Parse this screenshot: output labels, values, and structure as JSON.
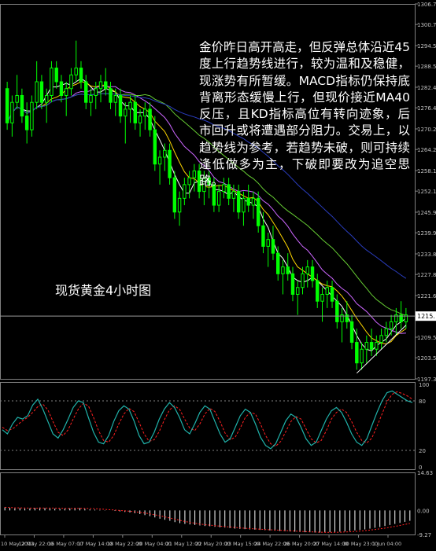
{
  "commentary": "金价昨日高开高走，但反弹总体沿近45度上行趋势线进行，较为温和及稳健，现涨势有所暂缓。MACD指标仍保持底背离形态缓慢上行，但现价接近MA40反压，且KD指标高位有转向迹象，后市回升或将遭遇部分阻力。交易上，以趋势线为参考，若趋势未破，则可持续逢低做多为主，下破即要改为追空思路。",
  "caption": "现货黄金4小时图",
  "colors": {
    "background": "#000000",
    "candle": "#00ff00",
    "ma_fast": "#ffffff",
    "ma_mid": "#ffd700",
    "ma_slow": "#cc66ff",
    "ma_long": "#66cc33",
    "ma_longest": "#2a3dbf",
    "kd_k": "#20b2aa",
    "kd_d": "#ff2020",
    "macd_hist": "#ffffff",
    "macd_signal": "#ff2020",
    "grid": "#808080",
    "axis_text": "#c0c0c0"
  },
  "chart_data": {
    "type": "candlestick",
    "price_axis": {
      "ticks": [
        "1306.70",
        "1300.70",
        "1294.55",
        "1288.55",
        "1282.40",
        "1276.40",
        "1270.25",
        "1264.25",
        "1258.10",
        "1252.10",
        "1245.95",
        "1239.95",
        "1233.80",
        "1227.80",
        "1221.65",
        "1215.65",
        "1209.50",
        "1203.50",
        "1197.35"
      ],
      "ylim": [
        1197.35,
        1306.7
      ],
      "current_price": "1215."
    },
    "kd_axis": {
      "ticks": [
        "100",
        "80",
        "20",
        "0"
      ],
      "ylim": [
        0,
        100
      ]
    },
    "macd_axis": {
      "ticks": [
        "14.63",
        "0.00",
        "-9.27"
      ],
      "ylim": [
        -9.27,
        14.63
      ]
    },
    "time_axis": [
      "10 May 2013",
      "12 May 22:00",
      "16 May 07:00",
      "17 May 14:00",
      "18 May 22:00",
      "20 May 04:00",
      "21 May 12:00",
      "22 May 20:00",
      "23 May 15:00",
      "24 May 22:00",
      "26 May 20:00",
      "27 May 14:00",
      "30 May 23:00",
      "1 Jun 04:00"
    ],
    "candles": [
      [
        1282,
        1284,
        1270,
        1272
      ],
      [
        1272,
        1280,
        1268,
        1278
      ],
      [
        1278,
        1286,
        1276,
        1280
      ],
      [
        1280,
        1282,
        1272,
        1274
      ],
      [
        1274,
        1278,
        1266,
        1270
      ],
      [
        1270,
        1280,
        1268,
        1278
      ],
      [
        1278,
        1290,
        1276,
        1284
      ],
      [
        1284,
        1286,
        1276,
        1278
      ],
      [
        1278,
        1282,
        1272,
        1280
      ],
      [
        1280,
        1290,
        1278,
        1288
      ],
      [
        1288,
        1290,
        1282,
        1284
      ],
      [
        1284,
        1286,
        1278,
        1280
      ],
      [
        1280,
        1284,
        1274,
        1282
      ],
      [
        1282,
        1288,
        1280,
        1286
      ],
      [
        1286,
        1296,
        1284,
        1288
      ],
      [
        1288,
        1290,
        1282,
        1284
      ],
      [
        1284,
        1286,
        1276,
        1278
      ],
      [
        1278,
        1282,
        1274,
        1280
      ],
      [
        1280,
        1284,
        1276,
        1282
      ],
      [
        1282,
        1286,
        1278,
        1284
      ],
      [
        1284,
        1288,
        1280,
        1282
      ],
      [
        1282,
        1284,
        1276,
        1278
      ],
      [
        1278,
        1282,
        1274,
        1280
      ],
      [
        1280,
        1282,
        1272,
        1274
      ],
      [
        1274,
        1278,
        1266,
        1276
      ],
      [
        1276,
        1280,
        1272,
        1278
      ],
      [
        1278,
        1280,
        1270,
        1272
      ],
      [
        1272,
        1276,
        1268,
        1274
      ],
      [
        1274,
        1278,
        1270,
        1276
      ],
      [
        1276,
        1278,
        1268,
        1270
      ],
      [
        1270,
        1274,
        1258,
        1260
      ],
      [
        1260,
        1264,
        1254,
        1262
      ],
      [
        1262,
        1266,
        1258,
        1264
      ],
      [
        1264,
        1266,
        1254,
        1256
      ],
      [
        1256,
        1258,
        1244,
        1246
      ],
      [
        1246,
        1252,
        1242,
        1250
      ],
      [
        1250,
        1256,
        1248,
        1254
      ],
      [
        1254,
        1258,
        1250,
        1256
      ],
      [
        1256,
        1260,
        1252,
        1258
      ],
      [
        1258,
        1260,
        1250,
        1252
      ],
      [
        1252,
        1258,
        1248,
        1256
      ],
      [
        1256,
        1258,
        1250,
        1254
      ],
      [
        1254,
        1256,
        1246,
        1248
      ],
      [
        1248,
        1254,
        1246,
        1252
      ],
      [
        1252,
        1256,
        1250,
        1254
      ],
      [
        1254,
        1256,
        1248,
        1250
      ],
      [
        1250,
        1254,
        1246,
        1252
      ],
      [
        1252,
        1254,
        1244,
        1246
      ],
      [
        1246,
        1252,
        1242,
        1250
      ],
      [
        1250,
        1254,
        1246,
        1248
      ],
      [
        1248,
        1252,
        1244,
        1250
      ],
      [
        1250,
        1252,
        1240,
        1242
      ],
      [
        1242,
        1246,
        1234,
        1236
      ],
      [
        1236,
        1240,
        1230,
        1238
      ],
      [
        1238,
        1242,
        1232,
        1234
      ],
      [
        1234,
        1236,
        1226,
        1228
      ],
      [
        1228,
        1232,
        1222,
        1230
      ],
      [
        1230,
        1234,
        1226,
        1228
      ],
      [
        1228,
        1230,
        1220,
        1222
      ],
      [
        1222,
        1226,
        1216,
        1224
      ],
      [
        1224,
        1230,
        1222,
        1228
      ],
      [
        1228,
        1232,
        1224,
        1230
      ],
      [
        1230,
        1232,
        1224,
        1226
      ],
      [
        1226,
        1228,
        1218,
        1220
      ],
      [
        1220,
        1224,
        1214,
        1222
      ],
      [
        1222,
        1226,
        1218,
        1224
      ],
      [
        1224,
        1226,
        1218,
        1220
      ],
      [
        1220,
        1222,
        1212,
        1214
      ],
      [
        1214,
        1218,
        1208,
        1216
      ],
      [
        1216,
        1220,
        1212,
        1214
      ],
      [
        1214,
        1216,
        1206,
        1208
      ],
      [
        1208,
        1212,
        1200,
        1202
      ],
      [
        1202,
        1208,
        1200,
        1206
      ],
      [
        1206,
        1210,
        1202,
        1208
      ],
      [
        1208,
        1212,
        1204,
        1206
      ],
      [
        1206,
        1210,
        1204,
        1208
      ],
      [
        1208,
        1212,
        1206,
        1210
      ],
      [
        1210,
        1214,
        1208,
        1212
      ],
      [
        1212,
        1216,
        1210,
        1214
      ],
      [
        1214,
        1218,
        1210,
        1216
      ],
      [
        1216,
        1220,
        1212,
        1214
      ],
      [
        1214,
        1218,
        1212,
        1216
      ]
    ],
    "kd_k": [
      45,
      40,
      52,
      60,
      58,
      62,
      75,
      82,
      70,
      55,
      40,
      35,
      45,
      58,
      72,
      80,
      78,
      60,
      42,
      30,
      28,
      38,
      55,
      68,
      74,
      70,
      56,
      38,
      28,
      30,
      42,
      58,
      70,
      78,
      72,
      60,
      45,
      40,
      52,
      66,
      74,
      70,
      55,
      40,
      30,
      34,
      48,
      62,
      70,
      66,
      52,
      36,
      26,
      22,
      28,
      42,
      56,
      64,
      60,
      48,
      34,
      26,
      30,
      44,
      58,
      68,
      72,
      66,
      54,
      40,
      30,
      26,
      34,
      50,
      66,
      80,
      90,
      92,
      88,
      84,
      80,
      78
    ],
    "kd_d": [
      48,
      44,
      46,
      51,
      56,
      60,
      66,
      73,
      76,
      69,
      55,
      42,
      38,
      45,
      58,
      70,
      77,
      74,
      60,
      44,
      32,
      30,
      38,
      52,
      64,
      71,
      67,
      54,
      40,
      31,
      33,
      43,
      57,
      69,
      74,
      70,
      58,
      47,
      44,
      52,
      64,
      71,
      67,
      55,
      41,
      33,
      36,
      47,
      60,
      66,
      64,
      52,
      38,
      28,
      25,
      31,
      43,
      55,
      61,
      58,
      46,
      34,
      29,
      32,
      44,
      58,
      66,
      70,
      66,
      55,
      42,
      32,
      29,
      35,
      49,
      64,
      79,
      88,
      91,
      89,
      86,
      82
    ],
    "macd_hist": [
      1.2,
      1.0,
      0.8,
      0.9,
      0.7,
      0.8,
      1.0,
      1.1,
      0.9,
      0.8,
      0.7,
      0.6,
      0.7,
      0.8,
      1.0,
      0.9,
      0.6,
      0.4,
      0.3,
      0.2,
      0.1,
      0.0,
      -0.2,
      -0.4,
      -0.6,
      -0.8,
      -1.1,
      -1.4,
      -1.8,
      -2.2,
      -2.7,
      -3.2,
      -3.6,
      -4.0,
      -4.5,
      -4.9,
      -5.2,
      -5.4,
      -5.6,
      -5.8,
      -6.0,
      -6.1,
      -6.3,
      -6.5,
      -6.6,
      -6.8,
      -7.0,
      -7.1,
      -7.2,
      -7.3,
      -7.4,
      -7.5,
      -7.6,
      -7.7,
      -7.8,
      -7.9,
      -8.0,
      -8.1,
      -8.2,
      -8.3,
      -8.4,
      -8.4,
      -8.5,
      -8.5,
      -8.4,
      -8.4,
      -8.3,
      -8.2,
      -8.1,
      -7.9,
      -7.7,
      -7.5,
      -7.3,
      -7.0,
      -6.7,
      -6.4,
      -6.0,
      -5.6,
      -5.2,
      -4.8,
      -4.4,
      -4.0
    ]
  }
}
